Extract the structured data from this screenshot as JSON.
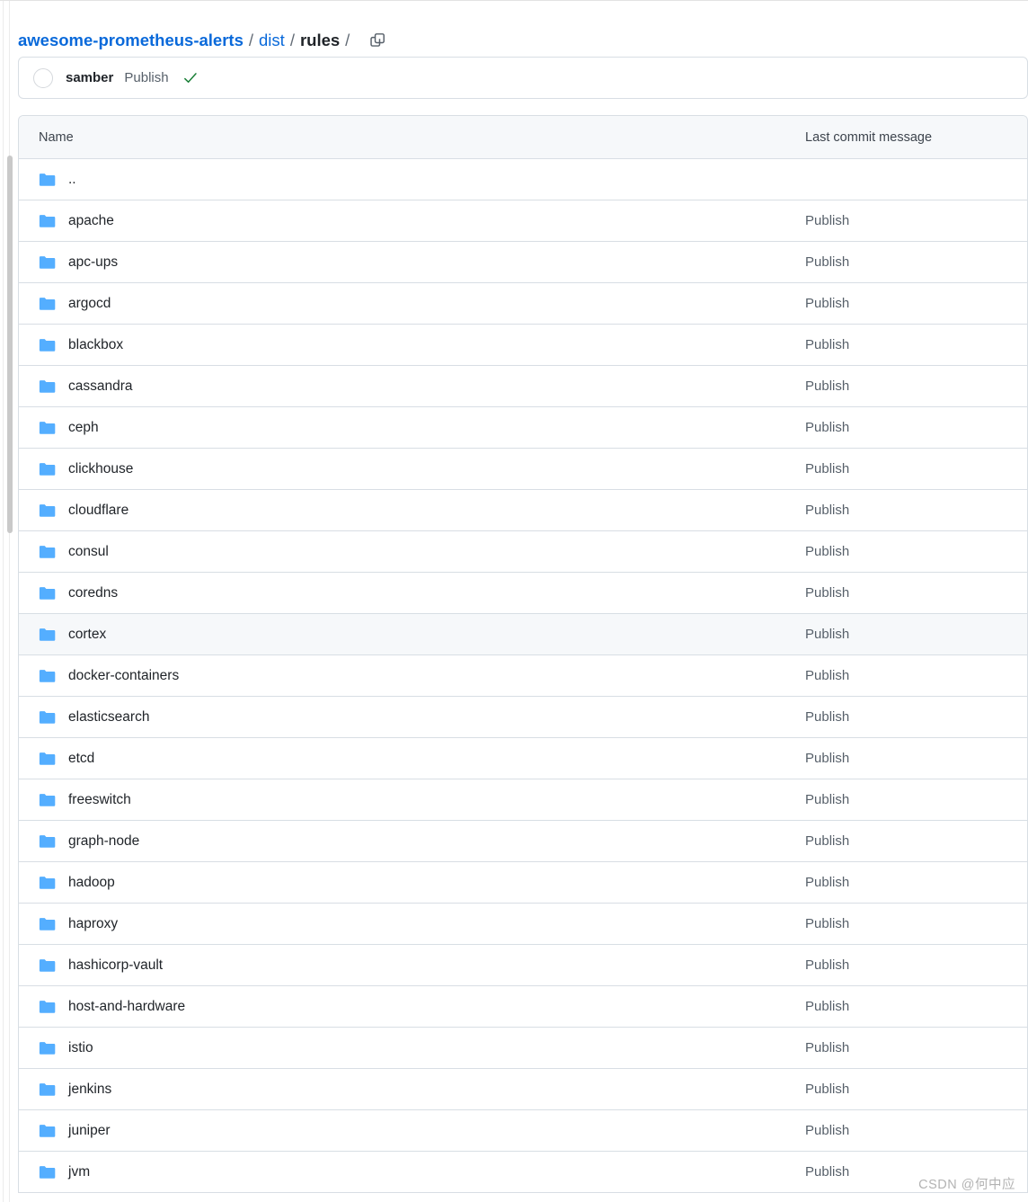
{
  "breadcrumb": {
    "repo": "awesome-prometheus-alerts",
    "sep1": "/",
    "dir1": "dist",
    "sep2": "/",
    "current": "rules",
    "sep3": "/",
    "copy_icon": "copy-path-icon"
  },
  "commit": {
    "avatar": "avatar-placeholder",
    "author": "samber",
    "message": "Publish",
    "status_icon": "check-icon",
    "status_color": "#1a7f37"
  },
  "table": {
    "columns": {
      "name": "Name",
      "last_commit_message": "Last commit message"
    },
    "rows": [
      {
        "name": "..",
        "icon": "folder-icon",
        "message": "",
        "highlighted": false
      },
      {
        "name": "apache",
        "icon": "folder-icon",
        "message": "Publish",
        "highlighted": false
      },
      {
        "name": "apc-ups",
        "icon": "folder-icon",
        "message": "Publish",
        "highlighted": false
      },
      {
        "name": "argocd",
        "icon": "folder-icon",
        "message": "Publish",
        "highlighted": false
      },
      {
        "name": "blackbox",
        "icon": "folder-icon",
        "message": "Publish",
        "highlighted": false
      },
      {
        "name": "cassandra",
        "icon": "folder-icon",
        "message": "Publish",
        "highlighted": false
      },
      {
        "name": "ceph",
        "icon": "folder-icon",
        "message": "Publish",
        "highlighted": false
      },
      {
        "name": "clickhouse",
        "icon": "folder-icon",
        "message": "Publish",
        "highlighted": false
      },
      {
        "name": "cloudflare",
        "icon": "folder-icon",
        "message": "Publish",
        "highlighted": false
      },
      {
        "name": "consul",
        "icon": "folder-icon",
        "message": "Publish",
        "highlighted": false
      },
      {
        "name": "coredns",
        "icon": "folder-icon",
        "message": "Publish",
        "highlighted": false
      },
      {
        "name": "cortex",
        "icon": "folder-icon",
        "message": "Publish",
        "highlighted": true
      },
      {
        "name": "docker-containers",
        "icon": "folder-icon",
        "message": "Publish",
        "highlighted": false
      },
      {
        "name": "elasticsearch",
        "icon": "folder-icon",
        "message": "Publish",
        "highlighted": false
      },
      {
        "name": "etcd",
        "icon": "folder-icon",
        "message": "Publish",
        "highlighted": false
      },
      {
        "name": "freeswitch",
        "icon": "folder-icon",
        "message": "Publish",
        "highlighted": false
      },
      {
        "name": "graph-node",
        "icon": "folder-icon",
        "message": "Publish",
        "highlighted": false
      },
      {
        "name": "hadoop",
        "icon": "folder-icon",
        "message": "Publish",
        "highlighted": false
      },
      {
        "name": "haproxy",
        "icon": "folder-icon",
        "message": "Publish",
        "highlighted": false
      },
      {
        "name": "hashicorp-vault",
        "icon": "folder-icon",
        "message": "Publish",
        "highlighted": false
      },
      {
        "name": "host-and-hardware",
        "icon": "folder-icon",
        "message": "Publish",
        "highlighted": false
      },
      {
        "name": "istio",
        "icon": "folder-icon",
        "message": "Publish",
        "highlighted": false
      },
      {
        "name": "jenkins",
        "icon": "folder-icon",
        "message": "Publish",
        "highlighted": false
      },
      {
        "name": "juniper",
        "icon": "folder-icon",
        "message": "Publish",
        "highlighted": false
      },
      {
        "name": "jvm",
        "icon": "folder-icon",
        "message": "Publish",
        "highlighted": false
      }
    ]
  },
  "watermark": "CSDN @何中应",
  "colors": {
    "link": "#0969da",
    "folder": "#54aeff",
    "border": "#d8dee4",
    "header_bg": "#f6f8fa",
    "success": "#1a7f37"
  }
}
